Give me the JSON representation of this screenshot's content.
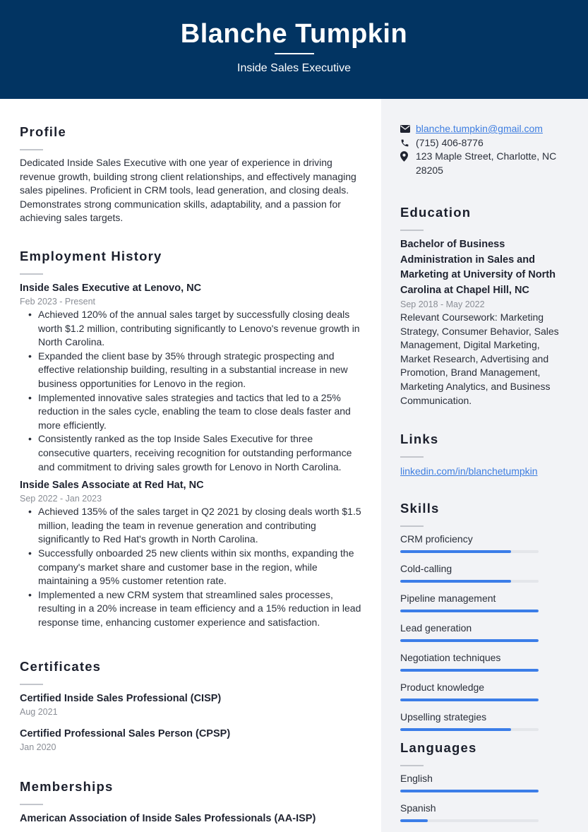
{
  "header": {
    "name": "Blanche Tumpkin",
    "title": "Inside Sales Executive"
  },
  "colors": {
    "header_bg": "#023462",
    "sidebar_bg": "#f2f3f6",
    "accent": "#3b7de8",
    "link": "#3d7de0"
  },
  "profile": {
    "heading": "Profile",
    "text": "Dedicated Inside Sales Executive with one year of experience in driving revenue growth, building strong client relationships, and effectively managing sales pipelines. Proficient in CRM tools, lead generation, and closing deals. Demonstrates strong communication skills, adaptability, and a passion for achieving sales targets."
  },
  "employment": {
    "heading": "Employment History",
    "jobs": [
      {
        "title": "Inside Sales Executive at Lenovo, NC",
        "dates": "Feb 2023 - Present",
        "bullets": [
          "Achieved 120% of the annual sales target by successfully closing deals worth $1.2 million, contributing significantly to Lenovo's revenue growth in North Carolina.",
          "Expanded the client base by 35% through strategic prospecting and effective relationship building, resulting in a substantial increase in new business opportunities for Lenovo in the region.",
          "Implemented innovative sales strategies and tactics that led to a 25% reduction in the sales cycle, enabling the team to close deals faster and more efficiently.",
          "Consistently ranked as the top Inside Sales Executive for three consecutive quarters, receiving recognition for outstanding performance and commitment to driving sales growth for Lenovo in North Carolina."
        ]
      },
      {
        "title": "Inside Sales Associate at Red Hat, NC",
        "dates": "Sep 2022 - Jan 2023",
        "bullets": [
          "Achieved 135% of the sales target in Q2 2021 by closing deals worth $1.5 million, leading the team in revenue generation and contributing significantly to Red Hat's growth in North Carolina.",
          "Successfully onboarded 25 new clients within six months, expanding the company's market share and customer base in the region, while maintaining a 95% customer retention rate.",
          "Implemented a new CRM system that streamlined sales processes, resulting in a 20% increase in team efficiency and a 15% reduction in lead response time, enhancing customer experience and satisfaction."
        ]
      }
    ]
  },
  "certificates": {
    "heading": "Certificates",
    "items": [
      {
        "title": "Certified Inside Sales Professional (CISP)",
        "date": "Aug 2021"
      },
      {
        "title": "Certified Professional Sales Person (CPSP)",
        "date": "Jan 2020"
      }
    ]
  },
  "memberships": {
    "heading": "Memberships",
    "items": [
      {
        "title": "American Association of Inside Sales Professionals (AA-ISP)"
      }
    ]
  },
  "contact": {
    "email": "blanche.tumpkin@gmail.com",
    "phone": "(715) 406-8776",
    "address": "123 Maple Street, Charlotte, NC 28205",
    "icons": {
      "email": "envelope-icon",
      "phone": "phone-icon",
      "address": "map-pin-icon"
    }
  },
  "education": {
    "heading": "Education",
    "degree": "Bachelor of Business Administration in Sales and Marketing at University of North Carolina at Chapel Hill, NC",
    "dates": "Sep 2018 - May 2022",
    "description": "Relevant Coursework: Marketing Strategy, Consumer Behavior, Sales Management, Digital Marketing, Market Research, Advertising and Promotion, Brand Management, Marketing Analytics, and Business Communication."
  },
  "links": {
    "heading": "Links",
    "items": [
      {
        "label": "linkedin.com/in/blanchetumpkin"
      }
    ]
  },
  "skills": {
    "heading": "Skills",
    "items": [
      {
        "label": "CRM proficiency",
        "level": 0.8
      },
      {
        "label": "Cold-calling",
        "level": 0.8
      },
      {
        "label": "Pipeline management",
        "level": 1.0
      },
      {
        "label": "Lead generation",
        "level": 1.0
      },
      {
        "label": "Negotiation techniques",
        "level": 1.0
      },
      {
        "label": "Product knowledge",
        "level": 1.0
      },
      {
        "label": "Upselling strategies",
        "level": 0.8
      }
    ]
  },
  "languages": {
    "heading": "Languages",
    "items": [
      {
        "label": "English",
        "level": 1.0
      },
      {
        "label": "Spanish",
        "level": 0.2
      }
    ]
  }
}
